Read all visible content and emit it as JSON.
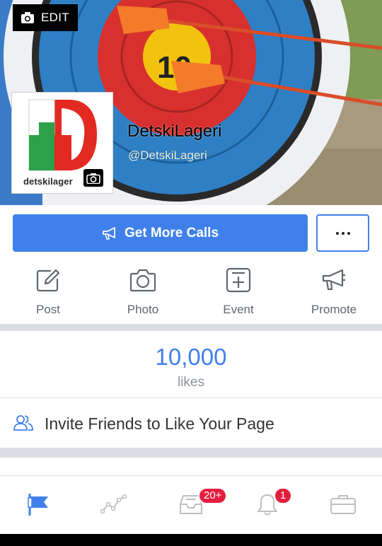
{
  "cover": {
    "edit_label": "EDIT"
  },
  "profile": {
    "logo_text": "detskilager",
    "page_name": "DetskiLageri",
    "page_handle": "@DetskiLageri"
  },
  "cta": {
    "label": "Get More Calls"
  },
  "actions": [
    {
      "label": "Post",
      "icon": "pencil-square-icon"
    },
    {
      "label": "Photo",
      "icon": "camera-icon"
    },
    {
      "label": "Event",
      "icon": "calendar-plus-icon"
    },
    {
      "label": "Promote",
      "icon": "megaphone-icon"
    }
  ],
  "likes": {
    "count": "10,000",
    "label": "likes"
  },
  "invite": {
    "label": "Invite Friends to Like Your Page"
  },
  "nav": {
    "items": [
      {
        "icon": "page-flag-icon",
        "active": true
      },
      {
        "icon": "insights-graph-icon",
        "active": false
      },
      {
        "icon": "inbox-icon",
        "active": false,
        "badge": "20+"
      },
      {
        "icon": "bell-icon",
        "active": false,
        "badge": "1"
      },
      {
        "icon": "briefcase-icon",
        "active": false
      }
    ]
  },
  "colors": {
    "accent": "#4080ea",
    "badge": "#e41e3f",
    "secondary_text": "#606770",
    "separator": "#dadde1"
  }
}
